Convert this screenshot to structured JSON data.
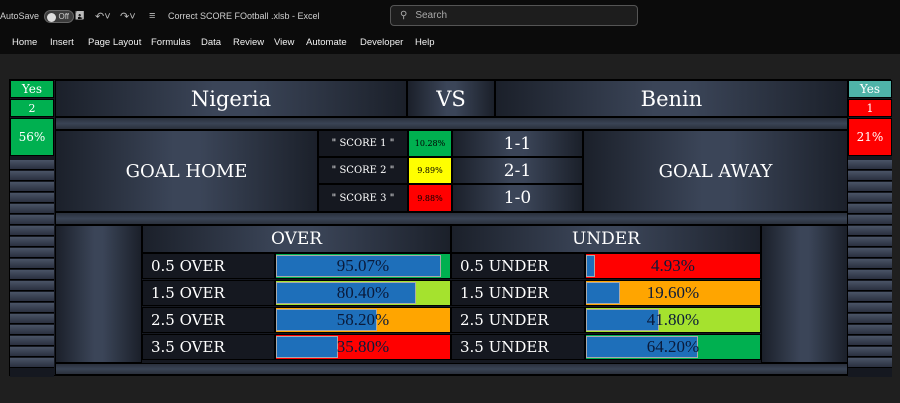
{
  "titlebar": {
    "autosave_label": "AutoSave",
    "autosave_state": "Off",
    "doc_title": "Correct SCORE FOotball .xlsb  -  Excel",
    "search_placeholder": "Search"
  },
  "menu": [
    "Home",
    "Insert",
    "Page Layout",
    "Formulas",
    "Data",
    "Review",
    "View",
    "Automate",
    "Developer",
    "Help"
  ],
  "match": {
    "home_team": "Nigeria",
    "vs_label": "VS",
    "away_team": "Benin",
    "goal_home_label": "GOAL HOME",
    "goal_away_label": "GOAL AWAY"
  },
  "home_side": {
    "flag": "Yes",
    "count": "2",
    "percent": "56%"
  },
  "away_side": {
    "flag": "Yes",
    "count": "1",
    "percent": "21%"
  },
  "scores": [
    {
      "label": "\" SCORE 1 \"",
      "prob": "10.28%",
      "result": "1-1",
      "color": "#00b050"
    },
    {
      "label": "\" SCORE 2 \"",
      "prob": "9.89%",
      "result": "2-1",
      "color": "#ffff00"
    },
    {
      "label": "\" SCORE 3 \"",
      "prob": "9.88%",
      "result": "1-0",
      "color": "#ff0000"
    }
  ],
  "over_header": "OVER",
  "under_header": "UNDER",
  "over": [
    {
      "label": "0.5 OVER",
      "percent": "95.07%",
      "fraction": 0.9507,
      "bg": "#00b050"
    },
    {
      "label": "1.5 OVER",
      "percent": "80.40%",
      "fraction": 0.804,
      "bg": "#a5e22e"
    },
    {
      "label": "2.5 OVER",
      "percent": "58.20%",
      "fraction": 0.582,
      "bg": "#ffa500"
    },
    {
      "label": "3.5 OVER",
      "percent": "35.80%",
      "fraction": 0.358,
      "bg": "#ff0000"
    }
  ],
  "under": [
    {
      "label": "0.5 UNDER",
      "percent": "4.93%",
      "fraction": 0.0493,
      "bg": "#ff0000"
    },
    {
      "label": "1.5 UNDER",
      "percent": "19.60%",
      "fraction": 0.196,
      "bg": "#ffa500"
    },
    {
      "label": "2.5 UNDER",
      "percent": "41.80%",
      "fraction": 0.418,
      "bg": "#a5e22e"
    },
    {
      "label": "3.5 UNDER",
      "percent": "64.20%",
      "fraction": 0.642,
      "bg": "#00b050"
    }
  ]
}
